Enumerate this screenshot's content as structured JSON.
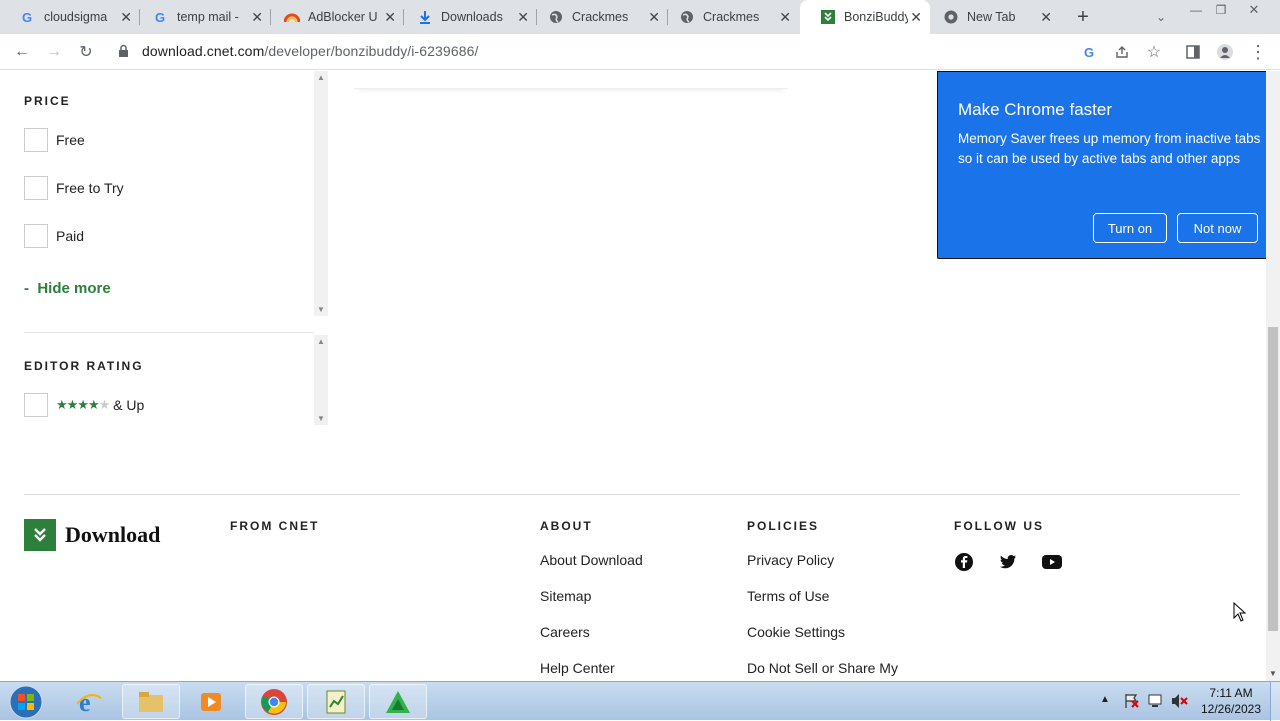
{
  "browser": {
    "tabs": [
      {
        "title": "cloudsigma",
        "icon": "google-icon"
      },
      {
        "title": "temp mail -",
        "icon": "google-icon"
      },
      {
        "title": "AdBlocker U",
        "icon": "adblocker-icon"
      },
      {
        "title": "Downloads",
        "icon": "download-icon"
      },
      {
        "title": "Crackmes",
        "icon": "globe-icon"
      },
      {
        "title": "Crackmes",
        "icon": "globe-icon"
      },
      {
        "title": "BonziBuddy",
        "icon": "download-com-icon",
        "active": true
      },
      {
        "title": "New Tab",
        "icon": "chrome-icon"
      }
    ],
    "url_host": "download.cnet.com",
    "url_path": "/developer/bonzibuddy/i-6239686/"
  },
  "filters": {
    "price_title": "PRICE",
    "price_options": [
      "Free",
      "Free to Try",
      "Paid"
    ],
    "hide_more": "Hide more",
    "hide_more_prefix": "-",
    "rating_title": "EDITOR RATING",
    "rating_stars": 4,
    "rating_suffix": "& Up"
  },
  "footer": {
    "brand": "Download",
    "from_cnet": "FROM CNET",
    "about_title": "ABOUT",
    "about_links": [
      "About Download",
      "Sitemap",
      "Careers",
      "Help Center"
    ],
    "policies_title": "POLICIES",
    "policies_links": [
      "Privacy Policy",
      "Terms of Use",
      "Cookie Settings",
      "Do Not Sell or Share My"
    ],
    "follow_title": "FOLLOW US",
    "social": [
      "facebook-icon",
      "twitter-icon",
      "youtube-icon"
    ]
  },
  "popup": {
    "title": "Make Chrome faster",
    "body": "Memory Saver frees up memory from inactive tabs so it can be used by active tabs and other apps",
    "turn_on": "Turn on",
    "not_now": "Not now"
  },
  "taskbar": {
    "time": "7:11 AM",
    "date": "12/26/2023"
  },
  "colors": {
    "brand_green": "#2d7f3c",
    "chrome_blue": "#1a73e8"
  }
}
